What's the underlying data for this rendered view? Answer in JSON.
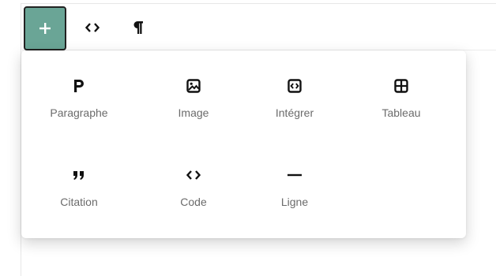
{
  "toolbar": {
    "add_label": "+",
    "code_icon": "code-icon",
    "paragraph_icon": "pilcrow-icon"
  },
  "menu": {
    "items": [
      {
        "label": "Paragraphe",
        "icon": "paragraph-p-icon"
      },
      {
        "label": "Image",
        "icon": "image-icon"
      },
      {
        "label": "Intégrer",
        "icon": "embed-icon"
      },
      {
        "label": "Tableau",
        "icon": "table-icon"
      },
      {
        "label": "Citation",
        "icon": "quote-icon"
      },
      {
        "label": "Code",
        "icon": "code-icon"
      },
      {
        "label": "Ligne",
        "icon": "horizontal-rule-icon"
      }
    ]
  },
  "colors": {
    "accent": "#6aa596",
    "icon": "#111111",
    "label": "#6b6b6b"
  }
}
